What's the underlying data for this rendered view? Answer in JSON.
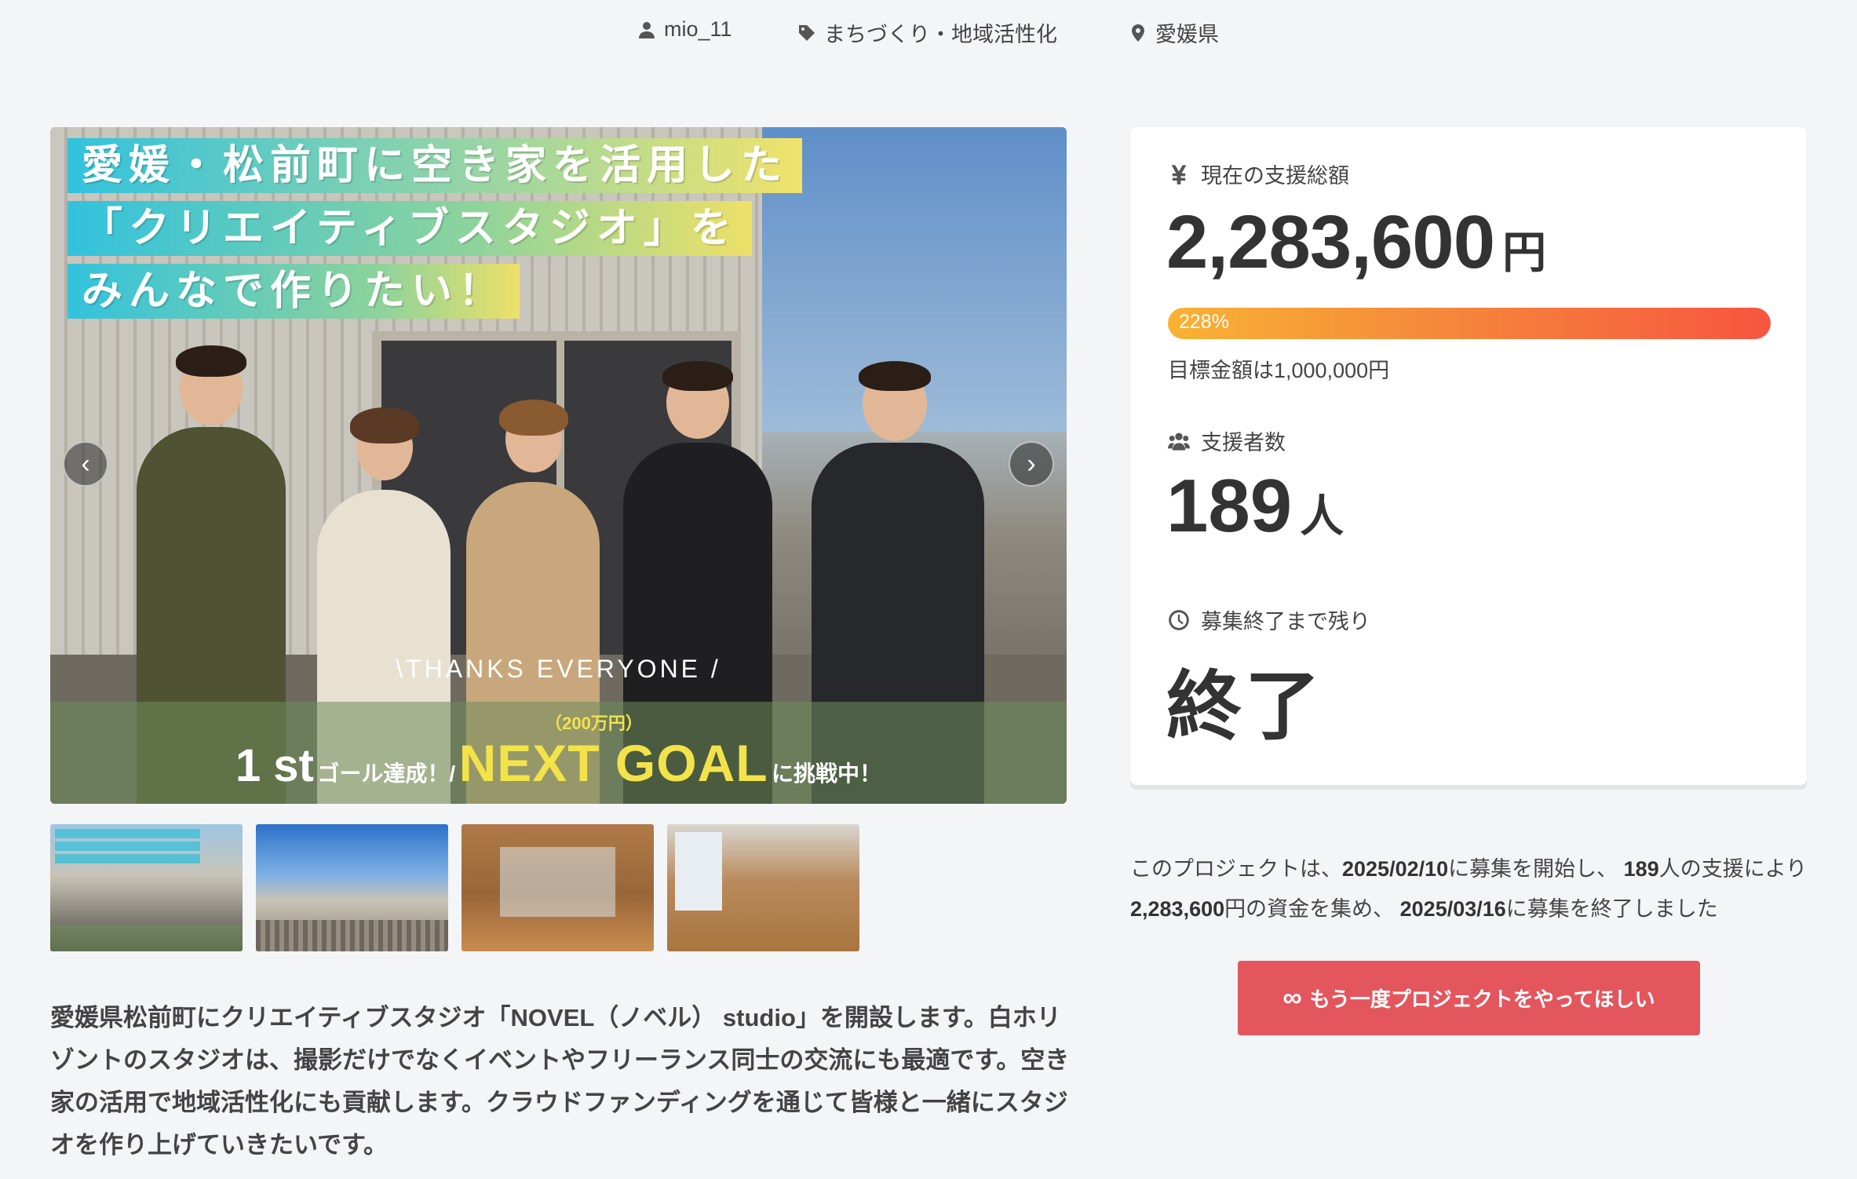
{
  "meta": {
    "user": "mio_11",
    "category": "まちづくり・地域活性化",
    "location": "愛媛県"
  },
  "hero": {
    "title_lines": [
      "愛媛・松前町に空き家を活用した",
      "「クリエイティブスタジオ」を",
      "みんなで作りたい！"
    ],
    "thanks": "\\THANKS EVERYONE /",
    "goal_first": "1 st",
    "goal_first_suffix": "ゴール達成！/",
    "goal_amount": "（200万円）",
    "goal_next": "NEXT GOAL",
    "goal_next_suffix": "に挑戦中！",
    "prev_arrow": "‹",
    "next_arrow": "›"
  },
  "description": "愛媛県松前町にクリエイティブスタジオ「NOVEL（ノベル） studio」を開設します。白ホリゾントのスタジオは、撮影だけでなくイベントやフリーランス同士の交流にも最適です。空き家の活用で地域活性化にも貢献します。クラウドファンディングを通じて皆様と一緒にスタジオを作り上げていきたいです。",
  "stats": {
    "total_label": "現在の支援総額",
    "total_amount": "2,283,600",
    "currency_unit": "円",
    "progress_percent": 228,
    "progress_label": "228%",
    "goal_text": "目標金額は1,000,000円",
    "backers_label": "支援者数",
    "backers_count": "189",
    "backers_unit": "人",
    "remaining_label": "募集終了まで残り",
    "remaining_value": "終了"
  },
  "summary": {
    "part1": "このプロジェクトは、",
    "start_date": "2025/02/10",
    "part2": "に募集を開始し、 ",
    "backers": "189",
    "part3": "人の支援により ",
    "amount": "2,283,600",
    "part4": "円の資金を集め、 ",
    "end_date": "2025/03/16",
    "part5": "に募集を終了しました"
  },
  "cta": {
    "icon": "∞",
    "label": "もう一度プロジェクトをやってほしい"
  },
  "colors": {
    "cta": "#e4565d",
    "progress_start": "#f9b233",
    "progress_end": "#f6553f"
  }
}
